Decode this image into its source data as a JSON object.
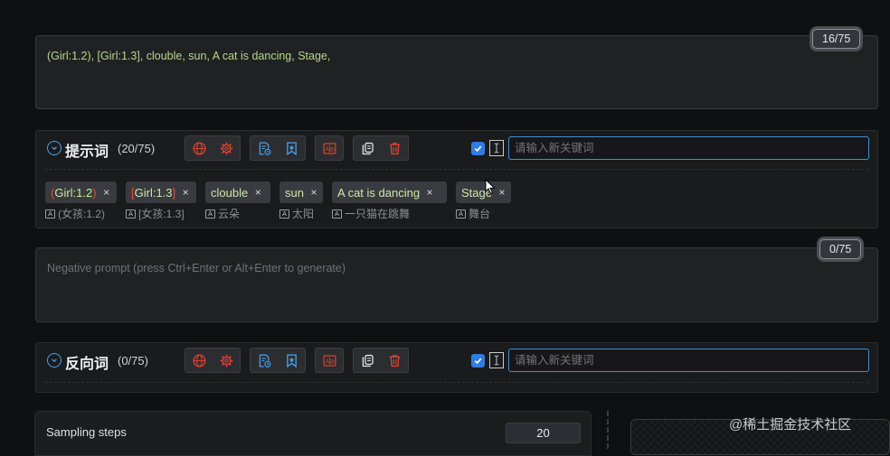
{
  "positive": {
    "counter": "16/75",
    "text": "(Girl:1.2), [Girl:1.3], clouble, sun, A cat is dancing, Stage,"
  },
  "prompt_section": {
    "title": "提示词",
    "count": "(20/75)",
    "keyword_placeholder": "请输入新关键词",
    "tags": [
      {
        "open": "(",
        "text": "Girl:1.2",
        "close": ")",
        "translation": "(女孩:1.2)"
      },
      {
        "open": "[",
        "text": "Girl:1.3",
        "close": "]",
        "translation": "[女孩:1.3]"
      },
      {
        "open": "",
        "text": "clouble",
        "close": "",
        "translation": "云朵"
      },
      {
        "open": "",
        "text": "sun",
        "close": "",
        "translation": "太阳"
      },
      {
        "open": "",
        "text": "A cat is dancing",
        "close": "",
        "translation": "一只猫在跳舞"
      },
      {
        "open": "",
        "text": "Stage",
        "close": "",
        "translation": "舞台"
      }
    ],
    "close_glyph": "×"
  },
  "negative": {
    "counter": "0/75",
    "placeholder": "Negative prompt (press Ctrl+Enter or Alt+Enter to generate)"
  },
  "negative_section": {
    "title": "反向词",
    "count": "(0/75)",
    "keyword_placeholder": "请输入新关键词"
  },
  "sampling": {
    "label": "Sampling steps",
    "value": "20"
  },
  "watermark": "@稀土掘金技术社区",
  "icons": {
    "translate": "globe-icon",
    "settings": "gear-icon",
    "history": "history-icon",
    "favorites": "bookmark-icon",
    "translate_tags": "translate-tags-icon",
    "copy": "copy-icon",
    "delete": "trash-icon"
  },
  "colors": {
    "accent_blue": "#45a3f0",
    "icon_red": "#e0402f",
    "icon_blue": "#4aa3f0",
    "tag_text": "#cfe6a6",
    "prompt_text": "#b6d68e"
  }
}
